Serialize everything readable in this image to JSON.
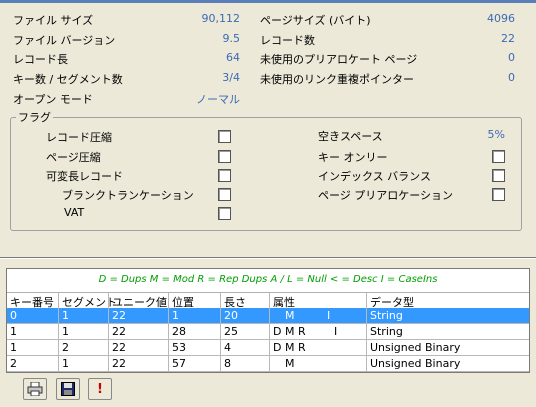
{
  "stats_left": [
    {
      "label": "ファイル サイズ",
      "value": "90,112"
    },
    {
      "label": "ファイル バージョン",
      "value": "9.5"
    },
    {
      "label": "レコード長",
      "value": "64"
    },
    {
      "label": "キー数 / セグメント数",
      "value": "3/4"
    },
    {
      "label": "オープン モード",
      "value": "ノーマル"
    }
  ],
  "stats_right": [
    {
      "label": "ページサイズ (バイト)",
      "value": "4096"
    },
    {
      "label": "レコード数",
      "value": "22"
    },
    {
      "label": "未使用のプリアロケート ページ",
      "value": "0"
    },
    {
      "label": "未使用のリンク重複ポインター",
      "value": "0"
    }
  ],
  "flags": {
    "title": "フラグ",
    "left": [
      {
        "label": "レコード圧縮",
        "checked": false
      },
      {
        "label": "ページ圧縮",
        "checked": false
      },
      {
        "label": "可変長レコード",
        "checked": false
      },
      {
        "label": "ブランクトランケーション",
        "checked": false
      },
      {
        "label": "VAT",
        "checked": false
      }
    ],
    "free_space_label": "空きスペース",
    "free_space_value": "5%",
    "right": [
      {
        "label": "キー オンリー",
        "checked": false
      },
      {
        "label": "インデックス バランス",
        "checked": false
      },
      {
        "label": "ページ プリアロケーション",
        "checked": false
      }
    ]
  },
  "key_table": {
    "legend": "D = Dups   M = Mod   R = Rep  Dups   A / L = Null   < = Desc   I = CaseIns",
    "columns": [
      "キー番号",
      "セグメント",
      "ユニーク値",
      "位置",
      "長さ",
      "属性",
      "データ型"
    ],
    "rows": [
      {
        "key": "0",
        "segment": "1",
        "unique": "22",
        "position": "1",
        "length": "20",
        "attr": "M",
        "attr2": "I",
        "type": "String",
        "selected": true
      },
      {
        "key": "1",
        "segment": "1",
        "unique": "22",
        "position": "28",
        "length": "25",
        "attr": "D M R",
        "attr2": "I",
        "type": "String",
        "selected": false
      },
      {
        "key": "1",
        "segment": "2",
        "unique": "22",
        "position": "53",
        "length": "4",
        "attr": "D M R",
        "attr2": "",
        "type": "Unsigned Binary",
        "selected": false
      },
      {
        "key": "2",
        "segment": "1",
        "unique": "22",
        "position": "57",
        "length": "8",
        "attr": "M",
        "attr2": "",
        "type": "Unsigned Binary",
        "selected": false
      }
    ]
  },
  "toolbar": {
    "print_icon": "printer-icon",
    "save_icon": "floppy-icon",
    "alert_icon": "exclamation-icon",
    "alert_color": "#cc0000"
  }
}
